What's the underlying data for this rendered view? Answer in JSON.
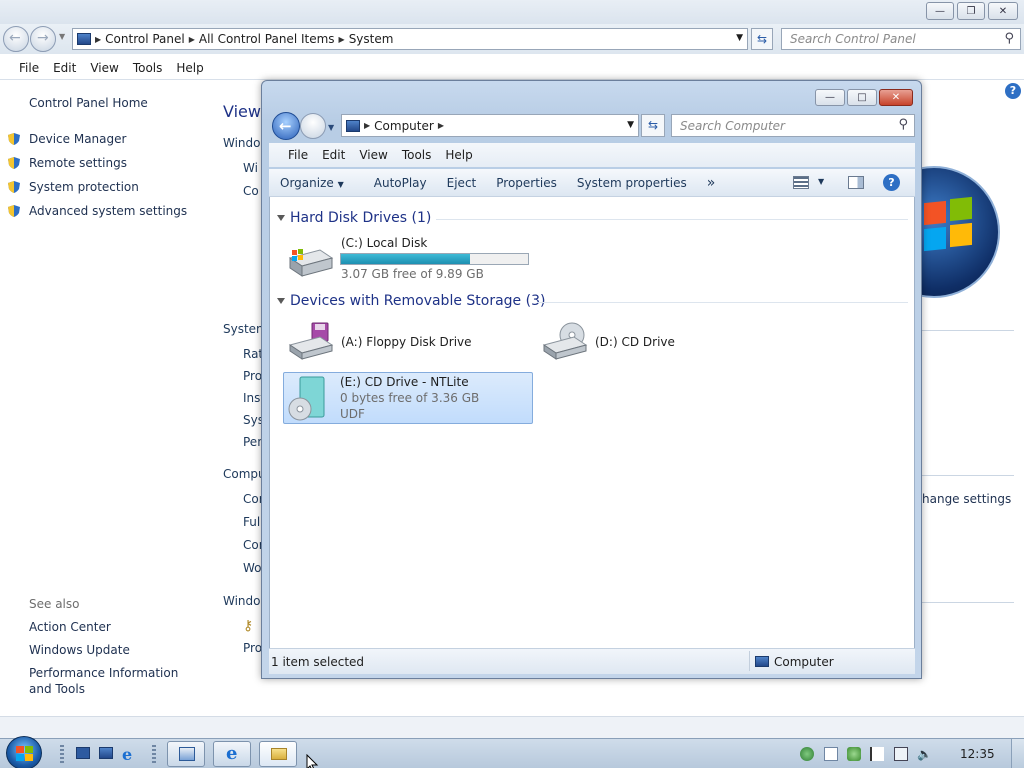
{
  "control_panel": {
    "breadcrumbs": [
      "Control Panel",
      "All Control Panel Items",
      "System"
    ],
    "search_placeholder": "Search Control Panel",
    "menu": [
      "File",
      "Edit",
      "View",
      "Tools",
      "Help"
    ],
    "home_link": "Control Panel Home",
    "task_links": [
      "Device Manager",
      "Remote settings",
      "System protection",
      "Advanced system settings"
    ],
    "see_also_header": "See also",
    "see_also_links": [
      "Action Center",
      "Windows Update",
      "Performance Information and Tools"
    ],
    "main_partial": {
      "heading": "View",
      "section1": "Windo",
      "s1_items": [
        "Wi",
        "Co"
      ],
      "section2": "System",
      "s2_items": [
        "Rat",
        "Pro",
        "Inst",
        "Sys",
        "Pen"
      ],
      "section3": "Compu",
      "s3_items": [
        "Cor",
        "Full",
        "Cor",
        "Wo"
      ],
      "section4": "Windo",
      "s4_items": [
        "Pro"
      ],
      "change_settings": "hange settings"
    }
  },
  "explorer": {
    "address_crumb": "Computer",
    "search_placeholder": "Search Computer",
    "menu": [
      "File",
      "Edit",
      "View",
      "Tools",
      "Help"
    ],
    "commands": [
      "Organize",
      "AutoPlay",
      "Eject",
      "Properties",
      "System properties"
    ],
    "more": "»",
    "groups": {
      "hdd": {
        "header": "Hard Disk Drives (1)",
        "items": [
          {
            "name": "(C:) Local Disk",
            "free": "3.07 GB free of 9.89 GB",
            "used_fraction": 0.69
          }
        ]
      },
      "removable": {
        "header": "Devices with Removable Storage (3)",
        "items": [
          {
            "name": "(A:) Floppy Disk Drive"
          },
          {
            "name": "(D:) CD Drive"
          },
          {
            "name": "(E:) CD Drive - NTLite",
            "free": "0 bytes free of 3.36 GB",
            "fs": "UDF",
            "selected": true
          }
        ]
      }
    },
    "status_left": "1 item selected",
    "status_right": "Computer"
  },
  "taskbar": {
    "clock": "12:35"
  },
  "colors": {
    "link": "#1e3050",
    "group_header": "#1e3287",
    "bar_fill": "#2aa3c4",
    "selection": "#c9e0fc"
  }
}
